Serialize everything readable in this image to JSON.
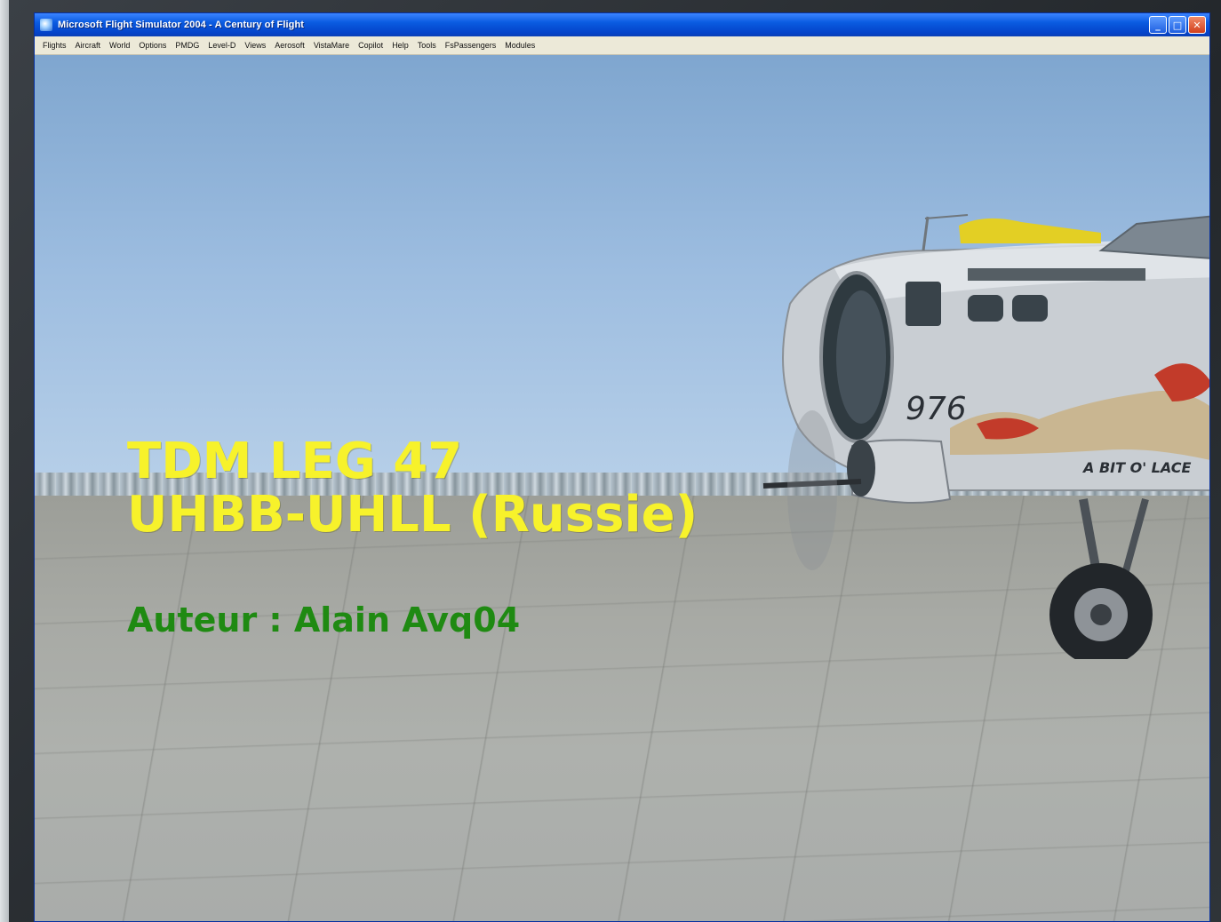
{
  "window": {
    "title": "Microsoft Flight Simulator 2004 - A Century of Flight",
    "controls": {
      "minimize": "_",
      "maximize": "□",
      "close": "✕"
    }
  },
  "menubar": {
    "items": [
      "Flights",
      "Aircraft",
      "World",
      "Options",
      "PMDG",
      "Level-D",
      "Views",
      "Aerosoft",
      "VistaMare",
      "Copilot",
      "Help",
      "Tools",
      "FsPassengers",
      "Modules"
    ]
  },
  "overlay": {
    "line1": "TDM LEG 47",
    "line2": "UHBB-UHLL (Russie)",
    "author": "Auteur : Alain Avq04"
  },
  "aircraft": {
    "tail_number": "976",
    "nose_art": "A BIT O' LACE"
  },
  "colors": {
    "title_text": "#f7f22b",
    "author_text": "#1f8a12",
    "titlebar": "#0a5be0"
  }
}
